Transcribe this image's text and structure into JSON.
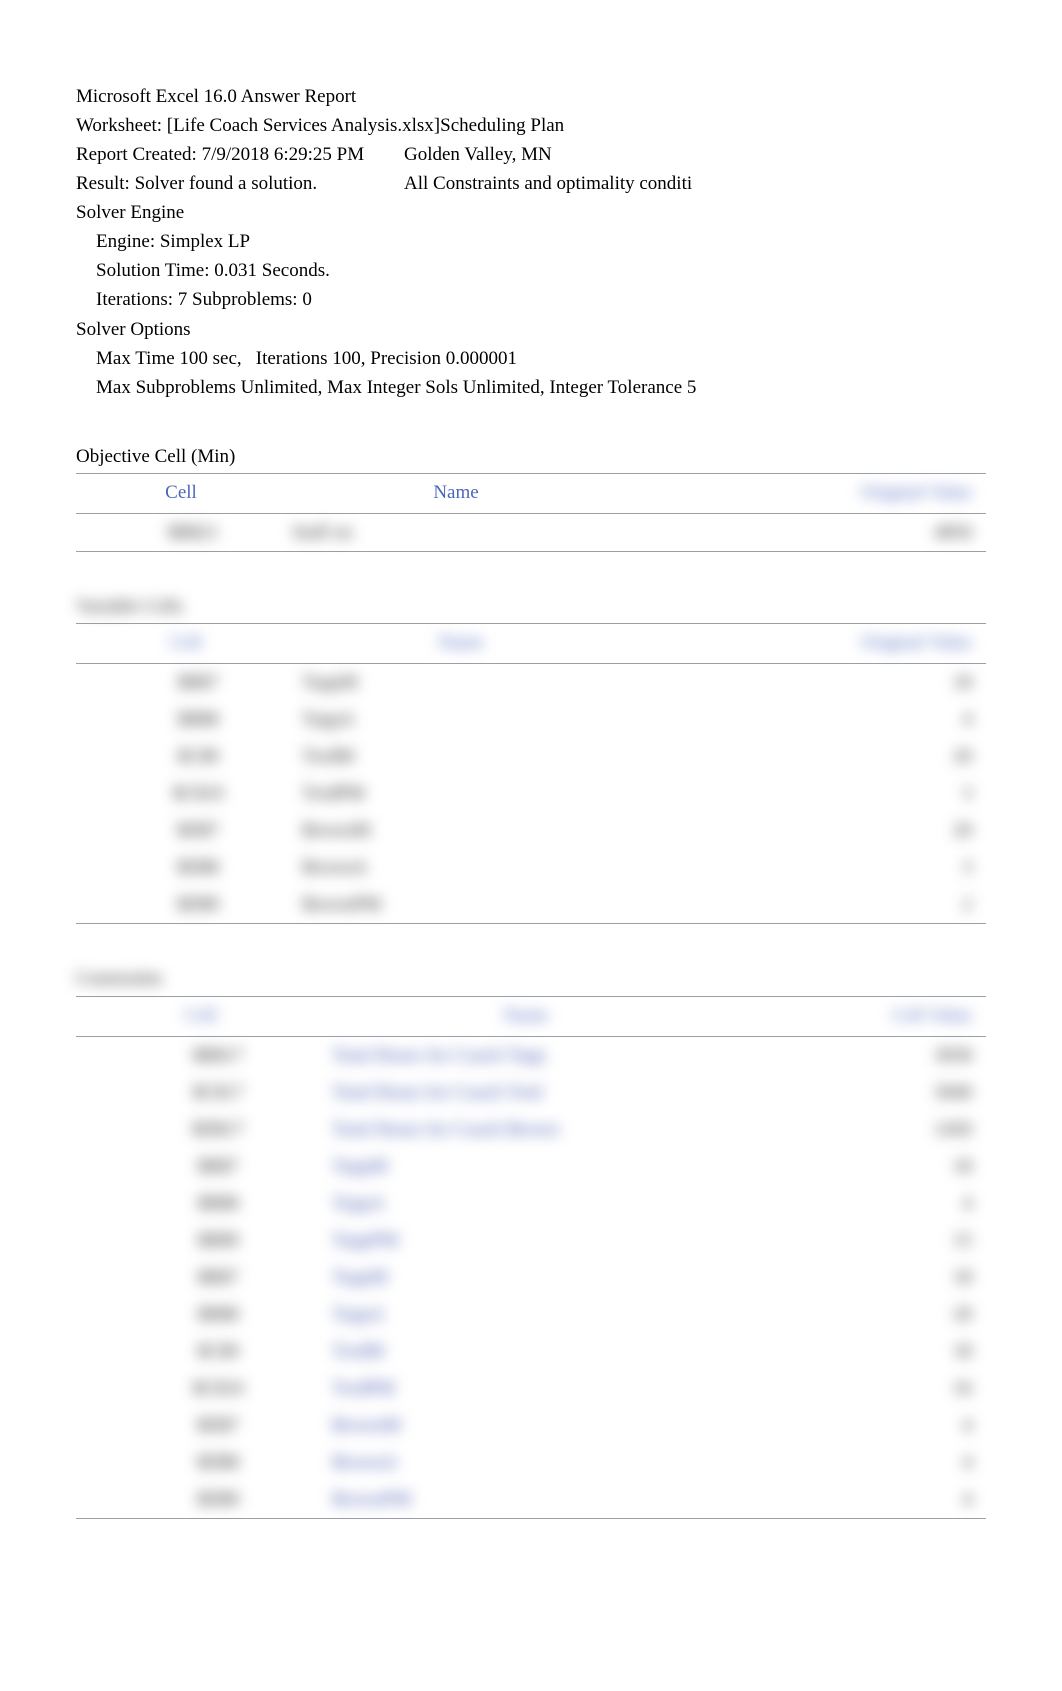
{
  "header": {
    "report_title": "Microsoft Excel 16.0 Answer Report",
    "worksheet_line": "Worksheet: [Life Coach Services Analysis.xlsx]Scheduling Plan",
    "report_created_label": "Report Created: 7/9/2018 6:29:25 PM",
    "report_created_right": "Golden Valley, MN",
    "result_label": "Result: Solver found a solution.",
    "result_right": "All Constraints and optimality conditi",
    "solver_engine_title": "Solver Engine",
    "engine_line": "Engine: Simplex LP",
    "solution_time_line": "Solution Time: 0.031 Seconds.",
    "iterations_line": "Iterations: 7 Subproblems: 0",
    "solver_options_title": "Solver Options",
    "options_line_1a": "Max Time 100 sec,",
    "options_line_1b": "Iterations 100, Precision 0.000001",
    "options_line_2": "Max Subproblems Unlimited, Max Integer Sols Unlimited, Integer Tolerance 5"
  },
  "objective": {
    "section_title": "Objective Cell (Min)",
    "col_cell": "Cell",
    "col_name": "Name",
    "col_orig": "Original Value",
    "rows": [
      {
        "cell": "$B$21",
        "name": "Staff on",
        "value": "4850"
      }
    ]
  },
  "variables": {
    "section_title": "Variable Cells",
    "col_cell": "Cell",
    "col_name": "Name",
    "col_orig": "Original Value",
    "rows": [
      {
        "cell": "$B$7",
        "name": "ToppM",
        "value": "18"
      },
      {
        "cell": "$B$8",
        "name": "ToppA",
        "value": "4"
      },
      {
        "cell": "$C$9",
        "name": "TredM",
        "value": "20"
      },
      {
        "cell": "$C$10",
        "name": "TredPM",
        "value": "3"
      },
      {
        "cell": "$D$7",
        "name": "BrownM",
        "value": "20"
      },
      {
        "cell": "$D$8",
        "name": "BrownA",
        "value": "3"
      },
      {
        "cell": "$D$9",
        "name": "BrownPM",
        "value": "2"
      }
    ]
  },
  "constraints": {
    "section_title": "Constraints",
    "col_cell": "Cell",
    "col_name": "Name",
    "col_value": "Cell Value",
    "rows": [
      {
        "cell": "$B$17",
        "name": "Total Hours for Coach Topp",
        "value": "3058"
      },
      {
        "cell": "$C$17",
        "name": "Total Hours for Coach Tred",
        "value": "3040"
      },
      {
        "cell": "$D$17",
        "name": "Total Hours for Coach Brown",
        "value": "1450"
      },
      {
        "cell": "$B$7",
        "name": "ToppM",
        "value": "18"
      },
      {
        "cell": "$B$8",
        "name": "ToppA",
        "value": "4"
      },
      {
        "cell": "$B$9",
        "name": "ToppPM",
        "value": "15"
      },
      {
        "cell": "$B$7",
        "name": "ToppM",
        "value": "18"
      },
      {
        "cell": "$B$8",
        "name": "ToppA",
        "value": "20"
      },
      {
        "cell": "$C$9",
        "name": "TredM",
        "value": "18"
      },
      {
        "cell": "$C$10",
        "name": "TredPM",
        "value": "16"
      },
      {
        "cell": "$D$7",
        "name": "BrownM",
        "value": "4"
      },
      {
        "cell": "$D$8",
        "name": "BrownA",
        "value": "4"
      },
      {
        "cell": "$D$9",
        "name": "BrownPM",
        "value": "4"
      }
    ]
  }
}
